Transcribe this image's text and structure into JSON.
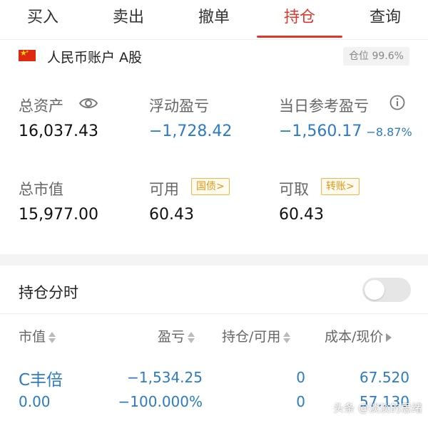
{
  "tabs": [
    {
      "label": "买入"
    },
    {
      "label": "卖出"
    },
    {
      "label": "撤单"
    },
    {
      "label": "持仓"
    },
    {
      "label": "查询"
    }
  ],
  "active_tab": "持仓",
  "account": {
    "name": "人民币账户 A股",
    "position_ratio": "仓位 99.6%"
  },
  "stats": {
    "total_assets": {
      "label": "总资产",
      "value": "16,037.43"
    },
    "floating_pnl": {
      "label": "浮动盈亏",
      "value": "−1,728.42"
    },
    "daily_pnl": {
      "label": "当日参考盈亏",
      "value": "−1,560.17",
      "pct": "−8.87%"
    },
    "market_value": {
      "label": "总市值",
      "value": "15,977.00"
    },
    "available": {
      "label": "可用",
      "value": "60.43",
      "tag": "国债>"
    },
    "withdrawable": {
      "label": "可取",
      "value": "60.43",
      "tag": "转账>"
    }
  },
  "timeshare": {
    "label": "持仓分时"
  },
  "table": {
    "headers": {
      "market_value": "市值",
      "pnl": "盈亏",
      "holding": "持仓/可用",
      "cost_price": "成本/现价"
    },
    "rows": [
      {
        "name": "C丰倍",
        "market_value": "0.00",
        "pnl": "−1,534.25",
        "pnl_pct": "−100.000%",
        "holding": "0",
        "available": "0",
        "cost": "67.520",
        "price": "57.130"
      }
    ]
  },
  "colors": {
    "accent_red": "#e0362c",
    "loss_blue": "#2b7bc5",
    "tag_gold": "#d99a15"
  },
  "watermark": "头条 @淡淡的思绪"
}
